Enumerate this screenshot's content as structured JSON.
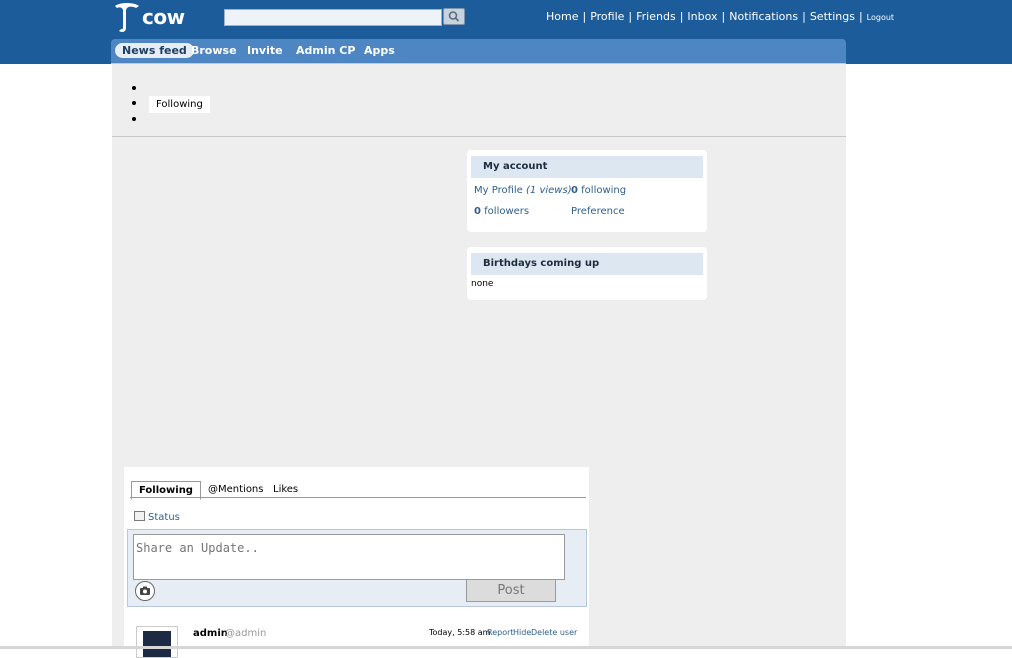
{
  "logo": {
    "text": "cow"
  },
  "search": {
    "placeholder": ""
  },
  "top_nav": {
    "home": "Home",
    "profile": "Profile",
    "friends": "Friends",
    "inbox": "Inbox",
    "notifications": "Notifications",
    "settings": "Settings",
    "logout": "Logout"
  },
  "main_nav": {
    "items": [
      {
        "label": "News feed",
        "active": true
      },
      {
        "label": "Browse"
      },
      {
        "label": "Invite"
      },
      {
        "label": "Admin CP"
      },
      {
        "label": "Apps"
      }
    ]
  },
  "sub_tabs": {
    "following": "Following"
  },
  "my_account": {
    "title": "My account",
    "profile_label": "My Profile",
    "profile_views": "(1 views)",
    "following_count": "0",
    "following_label": "following",
    "followers_count": "0",
    "followers_label": "followers",
    "preference": "Preference"
  },
  "birthdays": {
    "title": "Birthdays coming up",
    "value": "none"
  },
  "feed": {
    "tabs": [
      {
        "label": "Following",
        "active": true
      },
      {
        "label": "@Mentions"
      },
      {
        "label": "Likes"
      }
    ],
    "status_label": "Status",
    "update_placeholder": "Share an Update..",
    "post_button": "Post",
    "item": {
      "user": "admin",
      "handle": "@admin",
      "time": "Today, 5:58 am",
      "report": "Report",
      "hide": "Hide",
      "delete_user": "Delete user"
    }
  },
  "colors": {
    "header_blue": "#1c5c9b",
    "nav_blue": "#4d86c2",
    "link_blue": "#2e5f8c",
    "panel_header": "#dde7f2",
    "page_bg": "#eeeeee"
  }
}
